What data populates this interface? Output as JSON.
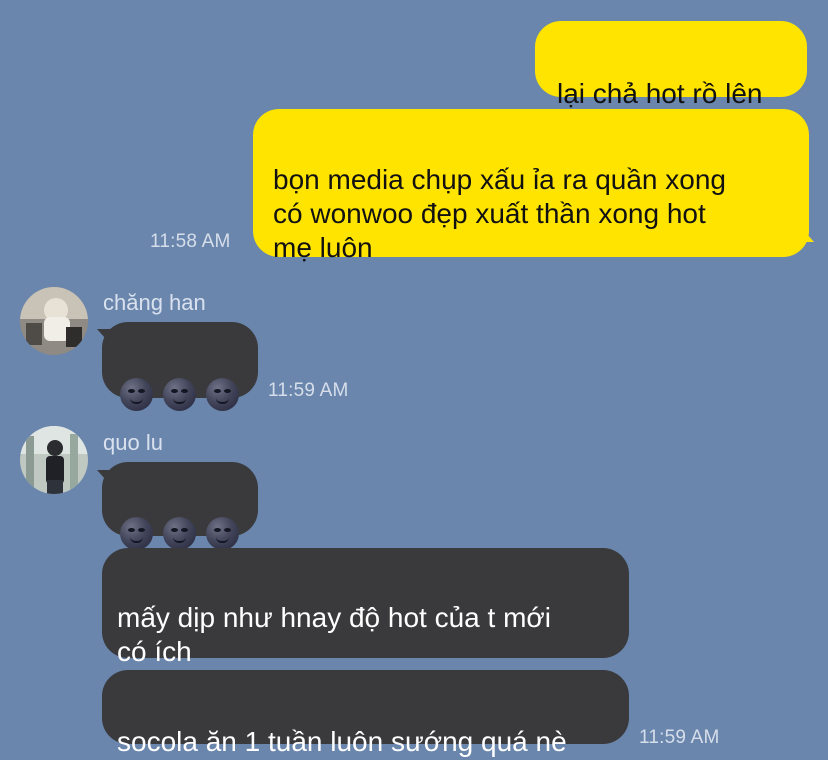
{
  "colors": {
    "background": "#6a86ad",
    "my_bubble": "#ffe400",
    "their_bubble": "#3a3a3c"
  },
  "messages": {
    "m1": {
      "text": "lại chả hot rồ lên"
    },
    "m2": {
      "text": "bọn media chụp xấu ỉa ra quần xong\ncó wonwoo đẹp xuất thần xong hot\nmẹ luôn"
    },
    "m2_time": "11:58 AM",
    "c1_sender": "chăng han",
    "c1_emoji": [
      "new-moon-face-icon",
      "new-moon-face-icon",
      "new-moon-face-icon"
    ],
    "c1_time": "11:59 AM",
    "c2_sender": "quo lu",
    "c2_emoji": [
      "new-moon-face-icon",
      "new-moon-face-icon",
      "new-moon-face-icon"
    ],
    "c2_msg2": "mấy dịp như hnay độ hot của t mới\ncó ích",
    "c2_msg3": "socola ăn 1 tuần luôn sướng quá nè",
    "c2_time": "11:59 AM"
  }
}
